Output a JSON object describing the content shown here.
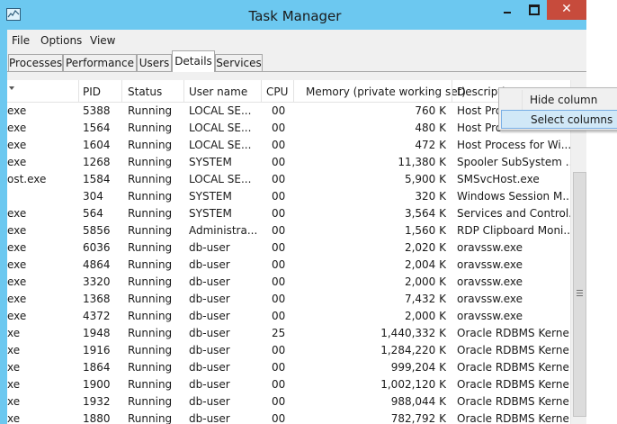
{
  "window": {
    "title": "Task Manager",
    "accent": "#6cc8f0",
    "close_color": "#c74b3c"
  },
  "menubar": [
    "File",
    "Options",
    "View"
  ],
  "tabs": [
    "Processes",
    "Performance",
    "Users",
    "Details",
    "Services"
  ],
  "active_tab": "Details",
  "columns": [
    "",
    "PID",
    "Status",
    "User name",
    "CPU",
    "Memory (private working set)",
    "Descripti"
  ],
  "rows": [
    {
      "name": "exe",
      "pid": "5388",
      "status": "Running",
      "user": "LOCAL SE...",
      "cpu": "00",
      "mem": "760 K",
      "desc": "Host Pro"
    },
    {
      "name": "exe",
      "pid": "1564",
      "status": "Running",
      "user": "LOCAL SE...",
      "cpu": "00",
      "mem": "480 K",
      "desc": "Host Pro"
    },
    {
      "name": "exe",
      "pid": "1604",
      "status": "Running",
      "user": "LOCAL SE...",
      "cpu": "00",
      "mem": "472 K",
      "desc": "Host Process for Wi..."
    },
    {
      "name": "exe",
      "pid": "1268",
      "status": "Running",
      "user": "SYSTEM",
      "cpu": "00",
      "mem": "11,380 K",
      "desc": "Spooler SubSystem ..."
    },
    {
      "name": "ost.exe",
      "pid": "1584",
      "status": "Running",
      "user": "LOCAL SE...",
      "cpu": "00",
      "mem": "5,900 K",
      "desc": "SMSvcHost.exe"
    },
    {
      "name": "",
      "pid": "304",
      "status": "Running",
      "user": "SYSTEM",
      "cpu": "00",
      "mem": "320 K",
      "desc": "Windows Session M..."
    },
    {
      "name": "exe",
      "pid": "564",
      "status": "Running",
      "user": "SYSTEM",
      "cpu": "00",
      "mem": "3,564 K",
      "desc": "Services and Control..."
    },
    {
      "name": "exe",
      "pid": "5856",
      "status": "Running",
      "user": "Administra...",
      "cpu": "00",
      "mem": "1,560 K",
      "desc": "RDP Clipboard Moni..."
    },
    {
      "name": "exe",
      "pid": "6036",
      "status": "Running",
      "user": "db-user",
      "cpu": "00",
      "mem": "2,020 K",
      "desc": "oravssw.exe"
    },
    {
      "name": "exe",
      "pid": "4864",
      "status": "Running",
      "user": "db-user",
      "cpu": "00",
      "mem": "2,004 K",
      "desc": "oravssw.exe"
    },
    {
      "name": "exe",
      "pid": "3320",
      "status": "Running",
      "user": "db-user",
      "cpu": "00",
      "mem": "2,000 K",
      "desc": "oravssw.exe"
    },
    {
      "name": "exe",
      "pid": "1368",
      "status": "Running",
      "user": "db-user",
      "cpu": "00",
      "mem": "7,432 K",
      "desc": "oravssw.exe"
    },
    {
      "name": "exe",
      "pid": "4372",
      "status": "Running",
      "user": "db-user",
      "cpu": "00",
      "mem": "2,000 K",
      "desc": "oravssw.exe"
    },
    {
      "name": "xe",
      "pid": "1948",
      "status": "Running",
      "user": "db-user",
      "cpu": "25",
      "mem": "1,440,332 K",
      "desc": "Oracle RDBMS Kerne..."
    },
    {
      "name": "xe",
      "pid": "1916",
      "status": "Running",
      "user": "db-user",
      "cpu": "00",
      "mem": "1,284,220 K",
      "desc": "Oracle RDBMS Kerne..."
    },
    {
      "name": "xe",
      "pid": "1864",
      "status": "Running",
      "user": "db-user",
      "cpu": "00",
      "mem": "999,204 K",
      "desc": "Oracle RDBMS Kerne..."
    },
    {
      "name": "xe",
      "pid": "1900",
      "status": "Running",
      "user": "db-user",
      "cpu": "00",
      "mem": "1,002,120 K",
      "desc": "Oracle RDBMS Kerne..."
    },
    {
      "name": "xe",
      "pid": "1932",
      "status": "Running",
      "user": "db-user",
      "cpu": "00",
      "mem": "988,044 K",
      "desc": "Oracle RDBMS Kerne..."
    },
    {
      "name": "xe",
      "pid": "1880",
      "status": "Running",
      "user": "db-user",
      "cpu": "00",
      "mem": "782,792 K",
      "desc": "Oracle RDBMS Kerne..."
    }
  ],
  "context_menu": {
    "items": [
      "Hide column",
      "Select columns"
    ],
    "highlighted": "Select columns"
  }
}
